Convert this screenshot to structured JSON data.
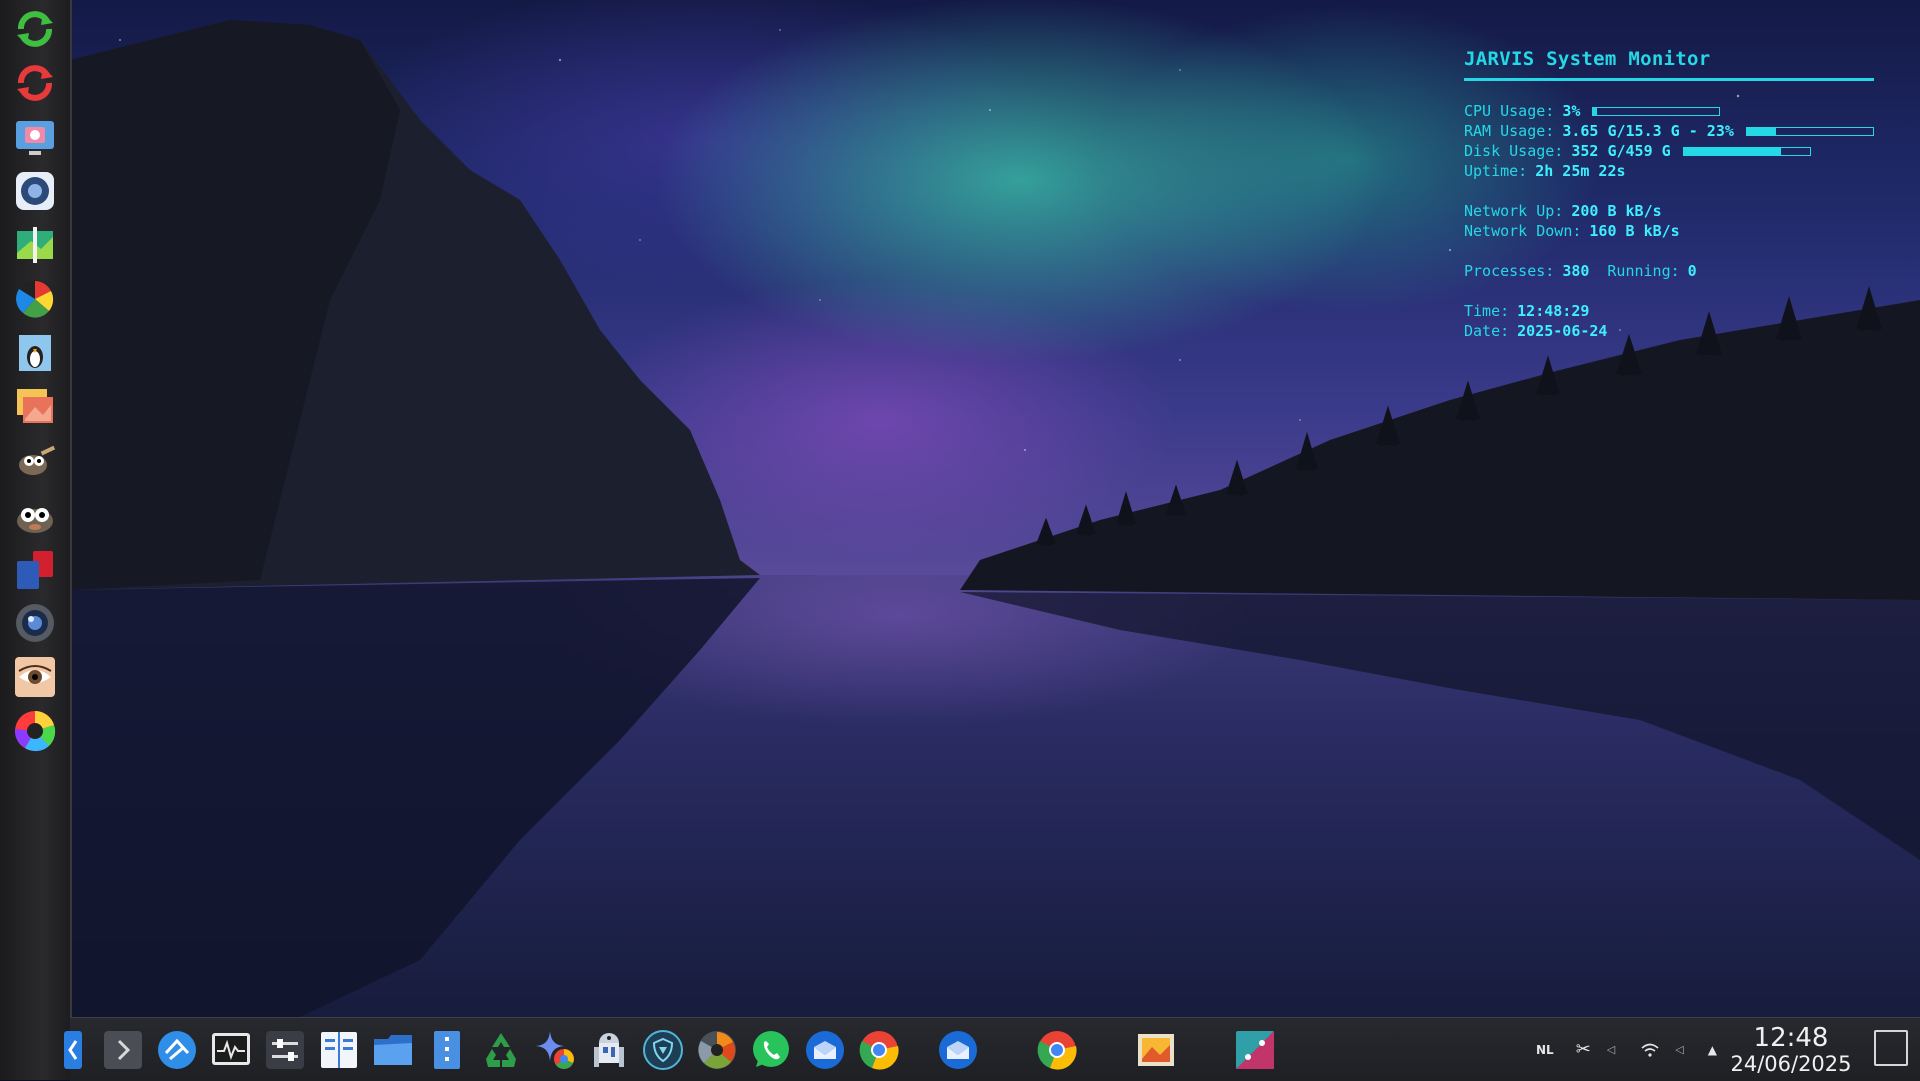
{
  "conky": {
    "title": "JARVIS System Monitor",
    "cpu_label": "CPU Usage:",
    "cpu_value": "3%",
    "cpu_percent": 3,
    "ram_label": "RAM Usage:",
    "ram_value": "3.65 G/15.3 G - 23%",
    "ram_percent": 23,
    "disk_label": "Disk Usage:",
    "disk_value": "352 G/459 G",
    "disk_percent": 77,
    "uptime_label": "Uptime:",
    "uptime_value": "2h 25m 22s",
    "net_up_label": "Network Up:",
    "net_up_value": "200 B kB/s",
    "net_down_label": "Network Down:",
    "net_down_value": "160 B kB/s",
    "processes_label": "Processes:",
    "processes_value": "380",
    "running_label": "Running:",
    "running_value": "0",
    "time_label": "Time:",
    "time_value": "12:48:29",
    "date_label": "Date:",
    "date_value": "2025-06-24",
    "accent": "#25d8e6"
  },
  "dock": {
    "items": [
      {
        "icon": "sync-green-icon"
      },
      {
        "icon": "sync-red-icon"
      },
      {
        "icon": "screenshot-camera-icon"
      },
      {
        "icon": "aperture-icon"
      },
      {
        "icon": "photo-tool-icon"
      },
      {
        "icon": "color-pinwheel-icon"
      },
      {
        "icon": "penguin-image-icon"
      },
      {
        "icon": "photo-stack-icon"
      },
      {
        "icon": "gimp-icon"
      },
      {
        "icon": "gimp-large-icon"
      },
      {
        "icon": "sd-card-icon"
      },
      {
        "icon": "lens-icon"
      },
      {
        "icon": "eye-icon"
      },
      {
        "icon": "color-wheel-icon"
      }
    ]
  },
  "taskbar": {
    "items": [
      {
        "icon": "app-menu-icon"
      },
      {
        "icon": "chevron-right-icon"
      },
      {
        "icon": "kdeconnect-icon"
      },
      {
        "icon": "system-monitor-icon"
      },
      {
        "icon": "settings-sliders-icon"
      },
      {
        "icon": "file-manager-split-icon"
      },
      {
        "icon": "folder-icon"
      },
      {
        "icon": "text-editor-icon"
      },
      {
        "icon": "recycle-icon"
      },
      {
        "icon": "chrome-gemini-icon"
      },
      {
        "icon": "r2d2-icon"
      },
      {
        "icon": "vpn-shield-icon"
      },
      {
        "icon": "aperture-orange-icon"
      },
      {
        "icon": "whatsapp-icon"
      },
      {
        "icon": "thunderbird-icon"
      },
      {
        "icon": "chrome-icon"
      },
      {
        "icon": "thunderbird-active-icon"
      },
      {
        "icon": "chrome-active-icon"
      },
      {
        "icon": "image-viewer-icon"
      },
      {
        "icon": "kdenlive-icon"
      }
    ],
    "tray": {
      "keyboard_layout": "NL",
      "clock_time": "12:48",
      "clock_date": "24/06/2025"
    }
  }
}
